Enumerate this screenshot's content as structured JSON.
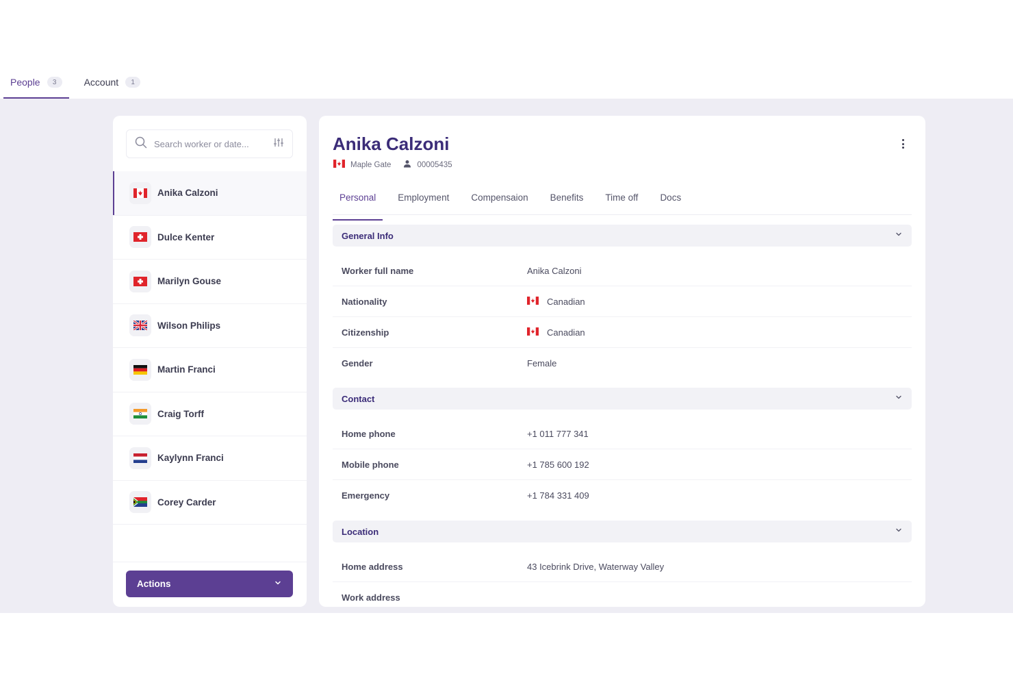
{
  "top_tabs": [
    {
      "label": "People",
      "count": "3"
    },
    {
      "label": "Account",
      "count": "1"
    }
  ],
  "search": {
    "placeholder": "Search worker or date..."
  },
  "workers": [
    {
      "name": "Anika Calzoni",
      "flag": "canada"
    },
    {
      "name": "Dulce Kenter",
      "flag": "switzerland"
    },
    {
      "name": "Marilyn Gouse",
      "flag": "switzerland"
    },
    {
      "name": "Wilson Philips",
      "flag": "united-kingdom"
    },
    {
      "name": "Martin Franci",
      "flag": "germany"
    },
    {
      "name": "Craig Torff",
      "flag": "india"
    },
    {
      "name": "Kaylynn Franci",
      "flag": "netherlands"
    },
    {
      "name": "Corey Carder",
      "flag": "south-africa"
    }
  ],
  "actions": {
    "label": "Actions"
  },
  "profile": {
    "name": "Anika Calzoni",
    "location": "Maple Gate",
    "worker_id": "00005435"
  },
  "detail_tabs": [
    "Personal",
    "Employment",
    "Compensaion",
    "Benefits",
    "Time off",
    "Docs"
  ],
  "sections": {
    "general": {
      "title": "General Info",
      "fields": [
        {
          "label": "Worker full name",
          "value": "Anika Calzoni"
        },
        {
          "label": "Nationality",
          "value": "Canadian"
        },
        {
          "label": "Citizenship",
          "value": "Canadian"
        },
        {
          "label": "Gender",
          "value": "Female"
        }
      ]
    },
    "contact": {
      "title": "Contact",
      "fields": [
        {
          "label": "Home phone",
          "value": "+1 011 777 341"
        },
        {
          "label": "Mobile phone",
          "value": "+1 785 600 192"
        },
        {
          "label": "Emergency",
          "value": "+1 784 331 409"
        }
      ]
    },
    "location": {
      "title": "Location",
      "fields": [
        {
          "label": "Home address",
          "value": "43 Icebrink Drive, Waterway Valley"
        },
        {
          "label": "Work address",
          "value": ""
        }
      ]
    }
  },
  "colors": {
    "accent": "#5c3f93",
    "title": "#3b2c78",
    "background": "#eeedf4"
  }
}
